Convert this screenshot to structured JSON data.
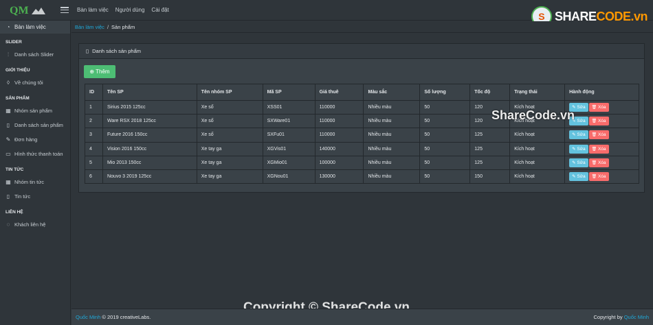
{
  "header": {
    "logo_text": "QM",
    "nav": [
      "Bàn làm việc",
      "Người dùng",
      "Cài đặt"
    ],
    "watermark_badge": "S",
    "watermark_brand_1": "SHARE",
    "watermark_brand_2": "CODE.vn"
  },
  "sidebar": {
    "dashboard_label": "Bàn làm việc",
    "sections": [
      {
        "title": "SLIDER",
        "items": [
          {
            "icon": "sliders-icon",
            "glyph": "⫶",
            "label": "Danh sách Slider"
          }
        ]
      },
      {
        "title": "GIỚI THIỆU",
        "items": [
          {
            "icon": "drop-icon",
            "glyph": "◊",
            "label": "Về chúng tôi"
          }
        ]
      },
      {
        "title": "SẢN PHẨM",
        "items": [
          {
            "icon": "grid-icon",
            "glyph": "▦",
            "label": "Nhóm sản phẩm"
          },
          {
            "icon": "clipboard-icon",
            "glyph": "▯",
            "label": "Danh sách sản phẩm"
          },
          {
            "icon": "edit-icon",
            "glyph": "✎",
            "label": "Đơn hàng"
          },
          {
            "icon": "credit-card-icon",
            "glyph": "▭",
            "label": "Hình thức thanh toán"
          }
        ]
      },
      {
        "title": "TIN TỨC",
        "items": [
          {
            "icon": "grid-icon",
            "glyph": "▦",
            "label": "Nhóm tin tức"
          },
          {
            "icon": "clipboard-icon",
            "glyph": "▯",
            "label": "Tin tức"
          }
        ]
      },
      {
        "title": "LIÊN HỆ",
        "items": [
          {
            "icon": "chat-icon",
            "glyph": "◌",
            "label": "Khách liên hệ"
          }
        ]
      }
    ]
  },
  "breadcrumb": {
    "parent": "Bàn làm việc",
    "separator": "/",
    "current": "Sản phẩm"
  },
  "card": {
    "title": "Danh sách sản phẩm",
    "add_label": "Thêm"
  },
  "table": {
    "headers": [
      "ID",
      "Tên SP",
      "Tên nhóm SP",
      "Mã SP",
      "Giá thuê",
      "Màu sắc",
      "Số lượng",
      "Tốc độ",
      "Trạng thái",
      "Hành động"
    ],
    "edit_label": "Sửa",
    "delete_label": "Xóa",
    "rows": [
      [
        "1",
        "Sirius 2015 125cc",
        "Xe số",
        "XSS01",
        "110000",
        "Nhiều màu",
        "50",
        "120",
        "Kích hoạt"
      ],
      [
        "2",
        "Ware RSX 2018 125cc",
        "Xe số",
        "SXWare01",
        "110000",
        "Nhiều màu",
        "50",
        "120",
        "Kích hoạt"
      ],
      [
        "3",
        "Future 2016 150cc",
        "Xe số",
        "SXFu01",
        "110000",
        "Nhiều màu",
        "50",
        "125",
        "Kích hoạt"
      ],
      [
        "4",
        "Vision 2016 150cc",
        "Xe tay ga",
        "XGVis01",
        "140000",
        "Nhiều màu",
        "50",
        "125",
        "Kích hoạt"
      ],
      [
        "5",
        "Mio 2013 150cc",
        "Xe tay ga",
        "XGMio01",
        "100000",
        "Nhiều màu",
        "50",
        "125",
        "Kích hoạt"
      ],
      [
        "6",
        "Nouvo 3 2019 125cc",
        "Xe tay ga",
        "XGNou01",
        "130000",
        "Nhiều màu",
        "50",
        "150",
        "Kích hoạt"
      ]
    ]
  },
  "watermarks": {
    "middle": "ShareCode.vn",
    "bottom": "Copyright © ShareCode.vn"
  },
  "footer": {
    "author": "Quốc Minh",
    "left_text": "© 2019 creativeLabs.",
    "right_prefix": "Copyright by",
    "right_author": "Quốc Minh"
  },
  "colors": {
    "accent": "#20a8d8",
    "success": "#4dbd74",
    "info": "#63c2de",
    "danger": "#f86c6b",
    "background": "#2f353a"
  }
}
